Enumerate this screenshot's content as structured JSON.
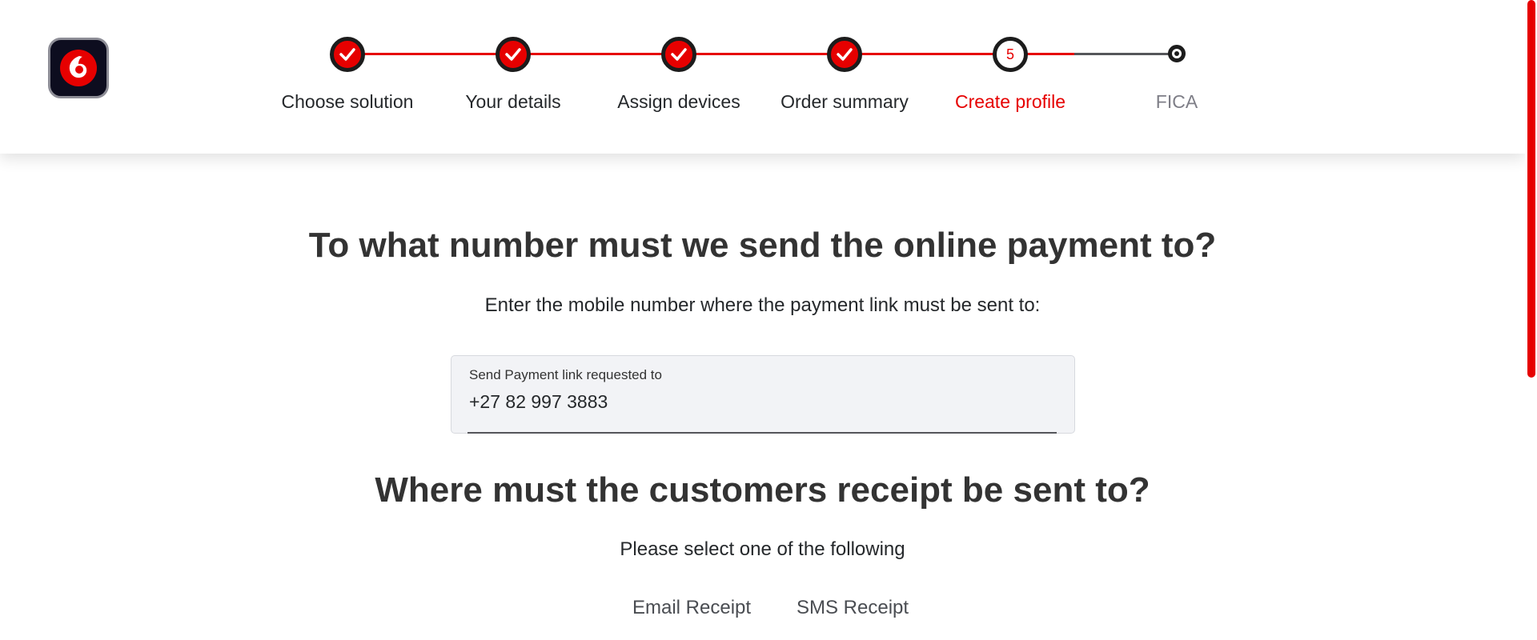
{
  "brand": {
    "logo_icon": "vodafone-logo-icon",
    "accent_color": "#e60000",
    "dark_color": "#1c1c1c"
  },
  "stepper": {
    "steps": [
      {
        "label": "Choose solution",
        "status": "completed",
        "icon": "check-icon"
      },
      {
        "label": "Your details",
        "status": "completed",
        "icon": "check-icon"
      },
      {
        "label": "Assign devices",
        "status": "completed",
        "icon": "check-icon"
      },
      {
        "label": "Order summary",
        "status": "completed",
        "icon": "check-icon"
      },
      {
        "label": "Create profile",
        "status": "current",
        "number": "5"
      },
      {
        "label": "FICA",
        "status": "upcoming"
      }
    ]
  },
  "payment": {
    "title": "To what number must we send the online payment to?",
    "subtitle": "Enter the mobile number where the payment link must be sent to:",
    "field_label": "Send Payment link requested to",
    "field_value": "+27 82 997 3883"
  },
  "receipt": {
    "title": "Where must the customers receipt be sent to?",
    "subtitle": "Please select one of the following",
    "options": [
      "Email Receipt",
      "SMS Receipt"
    ]
  }
}
